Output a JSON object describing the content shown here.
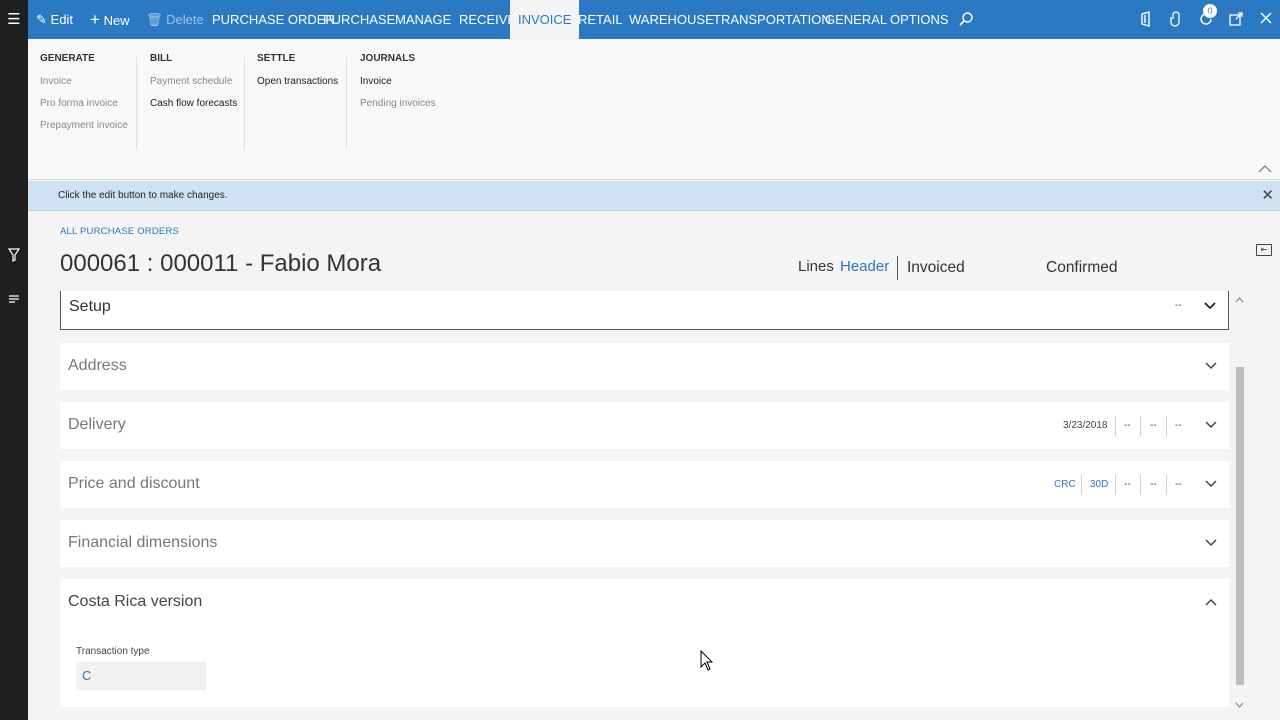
{
  "toolbar": {
    "edit": "Edit",
    "new": "New",
    "delete": "Delete",
    "tabs": [
      "PURCHASE ORDER",
      "PURCHASE",
      "MANAGE",
      "RECEIVE",
      "INVOICE",
      "RETAIL",
      "WAREHOUSE",
      "TRANSPORTATION",
      "GENERAL",
      "OPTIONS"
    ],
    "notification_count": "0"
  },
  "ribbon": {
    "generate": {
      "header": "GENERATE",
      "items": [
        "Invoice",
        "Pro forma invoice",
        "Prepayment invoice"
      ]
    },
    "bill": {
      "header": "BILL",
      "items": [
        "Payment schedule",
        "Cash flow forecasts"
      ]
    },
    "settle": {
      "header": "SETTLE",
      "items": [
        "Open transactions"
      ]
    },
    "journals": {
      "header": "JOURNALS",
      "items": [
        "Invoice",
        "Pending invoices"
      ]
    }
  },
  "infobar": {
    "message": "Click the edit button to make changes."
  },
  "page": {
    "breadcrumb": "ALL PURCHASE ORDERS",
    "title": "000061 : 000011 - Fabio Mora",
    "view_lines": "Lines",
    "view_header": "Header",
    "status_invoiced": "Invoiced",
    "status_confirmed": "Confirmed"
  },
  "fasttabs": {
    "setup": {
      "title": "Setup",
      "summary": [
        "--"
      ]
    },
    "address": {
      "title": "Address"
    },
    "delivery": {
      "title": "Delivery",
      "summary": [
        "3/23/2018",
        "--",
        "--",
        "--"
      ]
    },
    "price": {
      "title": "Price and discount",
      "summary": [
        "CRC",
        "30D",
        "--",
        "--",
        "--"
      ]
    },
    "financial": {
      "title": "Financial dimensions"
    },
    "costa_rica": {
      "title": "Costa Rica version",
      "field_label": "Transaction type",
      "field_value": "C"
    }
  },
  "colors": {
    "accent": "#2b79c2",
    "infobar": "#cfe2f3",
    "leftnav": "#1f1f1f"
  }
}
